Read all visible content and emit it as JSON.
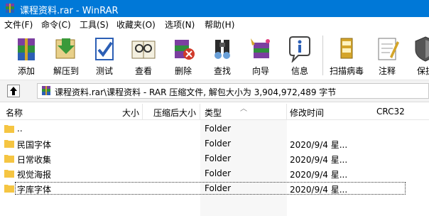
{
  "window": {
    "title": "课程资料.rar - WinRAR"
  },
  "menu": [
    "文件(F)",
    "命令(C)",
    "工具(S)",
    "收藏夹(O)",
    "选项(N)",
    "帮助(H)"
  ],
  "toolbar": {
    "buttons": [
      {
        "label": "添加",
        "icon": "add-archive-icon"
      },
      {
        "label": "解压到",
        "icon": "extract-to-icon"
      },
      {
        "label": "测试",
        "icon": "test-icon"
      },
      {
        "label": "查看",
        "icon": "view-icon"
      },
      {
        "label": "删除",
        "icon": "delete-icon"
      },
      {
        "label": "查找",
        "icon": "find-icon"
      },
      {
        "label": "向导",
        "icon": "wizard-icon"
      },
      {
        "label": "信息",
        "icon": "info-icon"
      },
      {
        "label": "扫描病毒",
        "icon": "virus-scan-icon"
      },
      {
        "label": "注释",
        "icon": "comment-icon"
      },
      {
        "label": "保护",
        "icon": "protect-icon"
      }
    ]
  },
  "address": {
    "path": "课程资料.rar\\课程资料 - RAR 压缩文件, 解包大小为 3,904,972,489 字节"
  },
  "columns": {
    "name": "名称",
    "size": "大小",
    "packed": "压缩后大小",
    "type": "类型",
    "modified": "修改时间",
    "crc": "CRC32"
  },
  "files": [
    {
      "name": "..",
      "type": "Folder",
      "modified": ""
    },
    {
      "name": "民国字体",
      "type": "Folder",
      "modified": "2020/9/4 星..."
    },
    {
      "name": "日常收集",
      "type": "Folder",
      "modified": "2020/9/4 星..."
    },
    {
      "name": "视觉海报",
      "type": "Folder",
      "modified": "2020/9/4 星..."
    },
    {
      "name": "字库字体",
      "type": "Folder",
      "modified": "2020/9/4 星..."
    }
  ],
  "colors": {
    "titlebar": "#0078d7",
    "folder": "#f5c542"
  }
}
